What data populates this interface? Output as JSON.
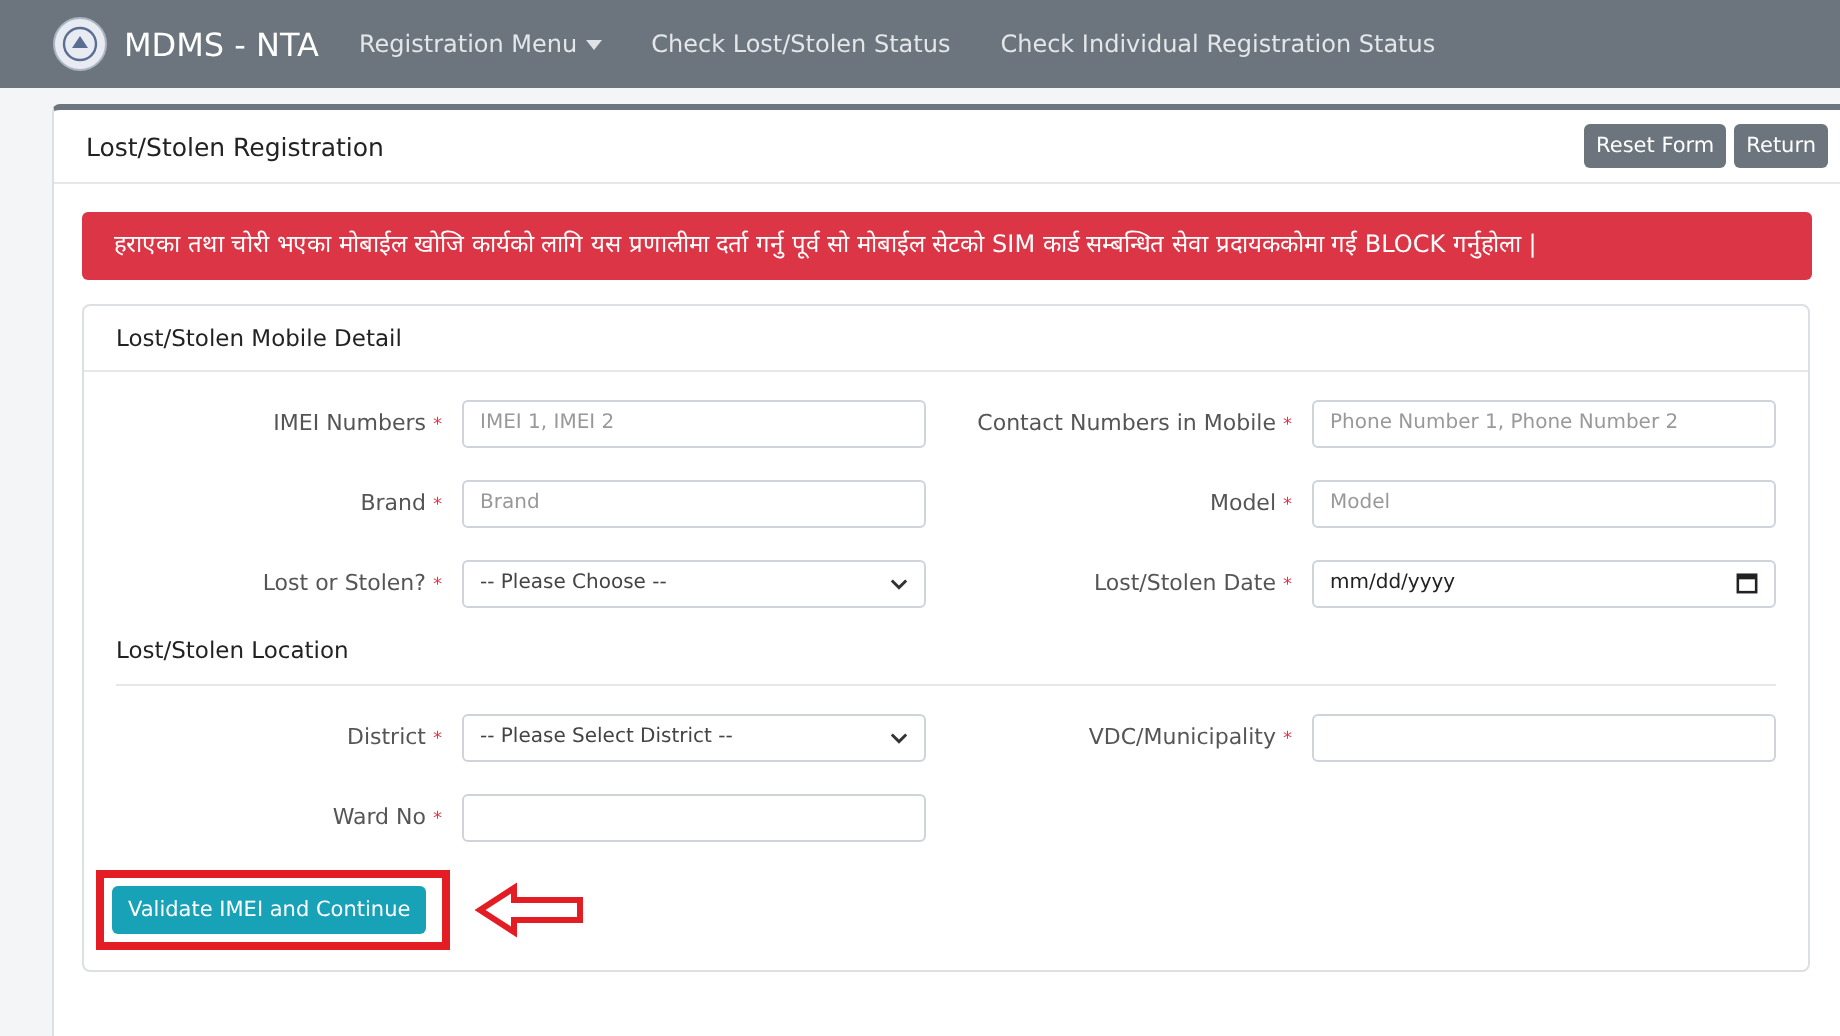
{
  "navbar": {
    "brand": "MDMS - NTA",
    "links": [
      {
        "label": "Registration Menu",
        "dropdown": true
      },
      {
        "label": "Check Lost/Stolen Status",
        "dropdown": false
      },
      {
        "label": "Check Individual Registration Status",
        "dropdown": false
      }
    ]
  },
  "page": {
    "title": "Lost/Stolen Registration",
    "buttons": [
      "Reset Form",
      "Return"
    ]
  },
  "alert": "हराएका तथा चोरी भएका मोबाईल खोजि कार्यको लागि यस प्रणालीमा दर्ता गर्नु पूर्व सो मोबाईल सेटको SIM कार्ड सम्बन्धित सेवा प्रदायककोमा गई BLOCK गर्नुहोला |",
  "form": {
    "title": "Lost/Stolen Mobile Detail",
    "sections": [
      {
        "fields": [
          {
            "kind": "input",
            "label": "IMEI Numbers",
            "required": "*",
            "placeholder": "IMEI 1, IMEI 2"
          },
          {
            "kind": "input",
            "label": "Contact Numbers in Mobile",
            "required": "*",
            "placeholder": "Phone Number 1, Phone Number 2"
          },
          {
            "kind": "input",
            "label": "Brand",
            "required": "*",
            "placeholder": "Brand"
          },
          {
            "kind": "input",
            "label": "Model",
            "required": "*",
            "placeholder": "Model"
          },
          {
            "kind": "select",
            "label": "Lost or Stolen?",
            "required": "*",
            "value": "-- Please Choose --"
          },
          {
            "kind": "date",
            "label": "Lost/Stolen Date",
            "required": "*",
            "value": "mm/dd/yyyy"
          }
        ]
      },
      {
        "title": "Lost/Stolen Location",
        "fields": [
          {
            "kind": "select",
            "label": "District",
            "required": "*",
            "value": "-- Please Select District --"
          },
          {
            "kind": "input",
            "label": "VDC/Municipality",
            "required": "*"
          },
          {
            "kind": "input",
            "label": "Ward No",
            "required": "*"
          }
        ]
      }
    ],
    "submit": "Validate IMEI and Continue"
  }
}
